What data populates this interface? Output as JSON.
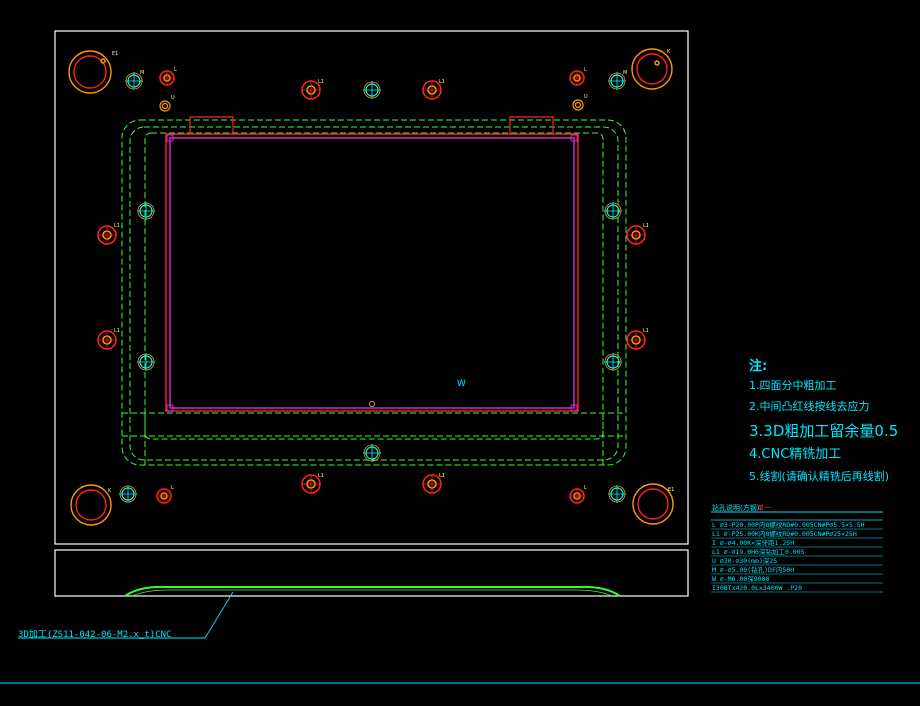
{
  "colors": {
    "background": "#000000",
    "frame": "#ffffff",
    "guide_dashed": "#33ff33",
    "cavity_outline": "#ff2020",
    "cavity_inner": "#ff33ff",
    "hole_orange": "#ff9900",
    "hole_red": "#ff2020",
    "hole_cyan": "#00ffff",
    "text_cyan": "#00e6ff",
    "bottom_line": "#00e6ff"
  },
  "notes": {
    "title": "注:",
    "items": [
      "1.四面分中粗加工",
      "2.中间凸红线按线去应力",
      "3.3D粗加工留余量0.5",
      "4.CNC精铣加工",
      "5.线割(请确认精铣后再线割)"
    ]
  },
  "table": {
    "header_left": "钻孔说明(方钢)",
    "header_right": "单一",
    "rows": [
      "L  ∅3-P20.00P内8螺纹RD#0.005CN#P∅5.5×5.5H",
      "L1 ∅-P25.00K内8螺纹RD#0.005CN#P∅25×25H",
      "I  ∅-∅4.00K×深牙距1.25H",
      "L1 ∅-∅19.0H6深钻加工0.005",
      "U  ∅30-∅30(mm)深25",
      "M  ∅-∅5.00(钻孔)DF内50H",
      "W  ∅-M6.00深9000",
      "I30BTx420.0Lx3400W .P20"
    ]
  },
  "callout": {
    "text": "3D加工(ZS11-042-06-M2.x_t)CNC"
  },
  "label_w": "W",
  "hole_tags": {
    "tl_big": "E1",
    "tr_big": "K",
    "bl_big": "K",
    "br_big": "E1",
    "small_l": "L",
    "small_l1": "L1",
    "small_m": "M",
    "small_u": "U"
  }
}
